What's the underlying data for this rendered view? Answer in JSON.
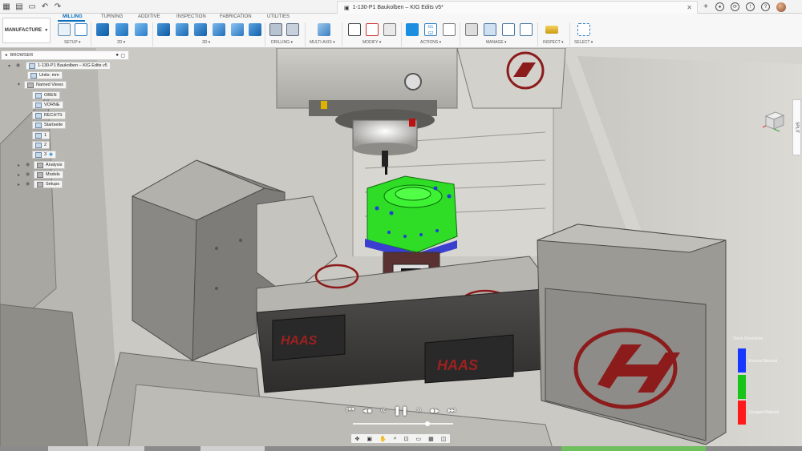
{
  "window": {
    "document_title": "1-130-P1 Baukolben – KIG Edits v5*"
  },
  "ribbon": {
    "workspace_label": "MANUFACTURE",
    "tabs": [
      "MILLING",
      "TURNING",
      "ADDITIVE",
      "INSPECTION",
      "FABRICATION",
      "UTILITIES"
    ],
    "active_tab": "MILLING",
    "groups": [
      "SETUP",
      "2D",
      "3D",
      "DRILLING",
      "MULTI-AXIS",
      "MODIFY",
      "ACTIONS",
      "MANAGE",
      "INSPECT",
      "SELECT"
    ]
  },
  "browser": {
    "title": "BROWSER",
    "root": "1-130-P1 Baukolben – KIG Edits v5",
    "units": "Units: mm",
    "named_views_label": "Named Views",
    "named_views": [
      "OBEN",
      "VORNE",
      "RECHTS",
      "Startseite",
      "1",
      "2",
      "3"
    ],
    "folders": [
      "Analysis",
      "Models",
      "Setups"
    ]
  },
  "side": {
    "splitter_label": "SPLIT"
  },
  "simulation_legend": {
    "title": "Stock Simulation",
    "items": [
      {
        "label": "Excess Material",
        "color": "#1736ff"
      },
      {
        "label": "",
        "color": "#19c419"
      },
      {
        "label": "Gouged Material",
        "color": "#ff1a1a"
      }
    ]
  },
  "scene": {
    "machine_brand": "HAAS",
    "part_color": "#2fdc26",
    "fixture_color": "#3a3fd0"
  },
  "playback": {
    "icons": [
      "skip-start",
      "step-back",
      "rewind",
      "pause",
      "fast-forward",
      "step-forward",
      "skip-end"
    ]
  },
  "navbar": {
    "icons": [
      "orbit",
      "look-at",
      "pan",
      "zoom",
      "fit",
      "display",
      "grid",
      "viewports"
    ]
  }
}
